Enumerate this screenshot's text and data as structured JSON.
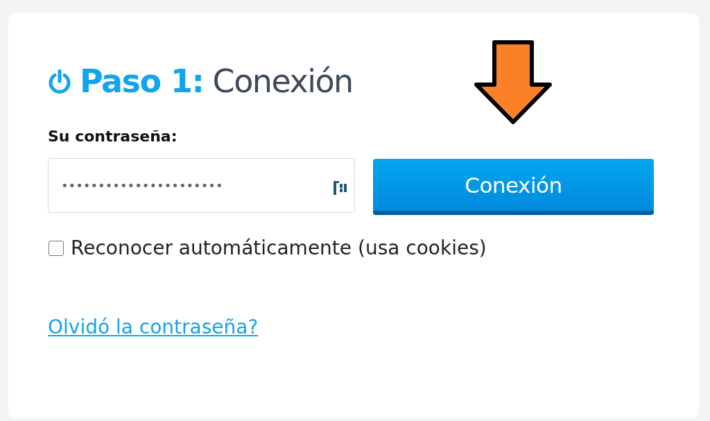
{
  "card": {
    "title": "**Paso 1:** Conexión",
    "password": {
      "label": "Su contraseña:",
      "value": "••••••••••••••••••••••"
    },
    "submit_button": "Conexión",
    "remember": {
      "label": "Reconocer automáticamente (usa cookies)",
      "checked": false
    },
    "forgot_link": "Olvidó la contraseña?"
  }
}
